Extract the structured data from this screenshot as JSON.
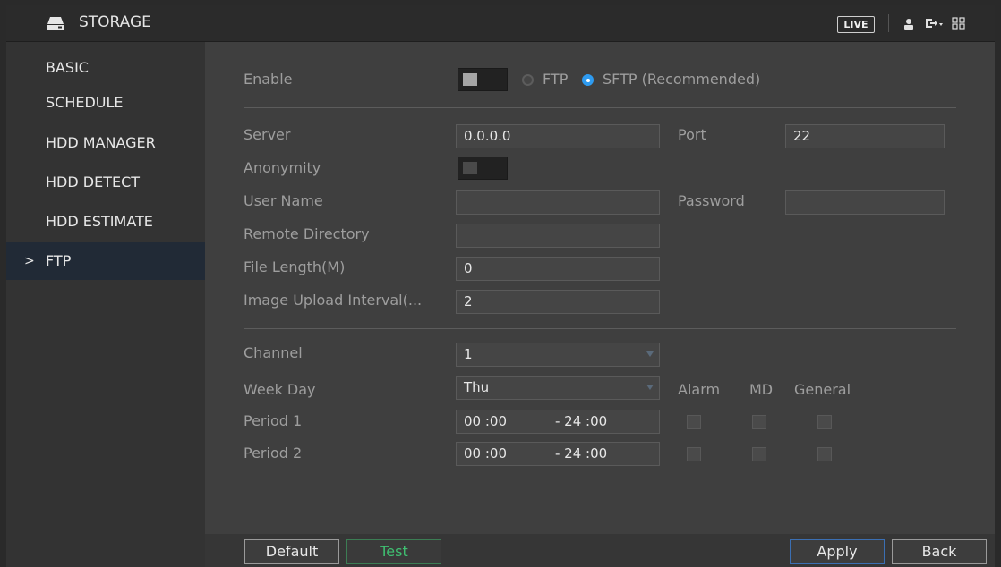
{
  "header": {
    "title": "STORAGE",
    "live_label": "LIVE",
    "icons": [
      "hdd-icon",
      "user-icon",
      "logout-icon",
      "grid-icon"
    ]
  },
  "sidebar": {
    "items": [
      {
        "label": "BASIC",
        "active": false
      },
      {
        "label": "SCHEDULE",
        "active": false
      },
      {
        "label": "HDD MANAGER",
        "active": false
      },
      {
        "label": "HDD DETECT",
        "active": false
      },
      {
        "label": "HDD ESTIMATE",
        "active": false
      },
      {
        "label": "FTP",
        "active": true
      }
    ],
    "active_chevron": ">"
  },
  "ftp": {
    "enable_label": "Enable",
    "enable_on": true,
    "protocol_options": [
      "FTP",
      "SFTP (Recommended)"
    ],
    "protocol_selected": "SFTP (Recommended)",
    "server_label": "Server",
    "server_value": "0.0.0.0",
    "port_label": "Port",
    "port_value": "22",
    "anonymity_label": "Anonymity",
    "anonymity_on": false,
    "username_label": "User Name",
    "username_value": "",
    "password_label": "Password",
    "password_value": "",
    "remote_dir_label": "Remote Directory",
    "remote_dir_value": "",
    "file_length_label": "File Length(M)",
    "file_length_value": "0",
    "upload_interval_label": "Image Upload Interval(...",
    "upload_interval_value": "2",
    "channel_label": "Channel",
    "channel_value": "1",
    "weekday_label": "Week Day",
    "weekday_value": "Thu",
    "col_headers": [
      "Alarm",
      "MD",
      "General"
    ],
    "periods": [
      {
        "label": "Period 1",
        "start": "00 :00",
        "end": "- 24 :00",
        "alarm": false,
        "md": false,
        "general": false
      },
      {
        "label": "Period 2",
        "start": "00 :00",
        "end": "- 24 :00",
        "alarm": false,
        "md": false,
        "general": false
      }
    ]
  },
  "buttons": {
    "default": "Default",
    "test": "Test",
    "apply": "Apply",
    "back": "Back"
  },
  "colors": {
    "accent_blue": "#2e9bf0",
    "test_green": "#3fbf71",
    "active_nav": "#212a36"
  }
}
